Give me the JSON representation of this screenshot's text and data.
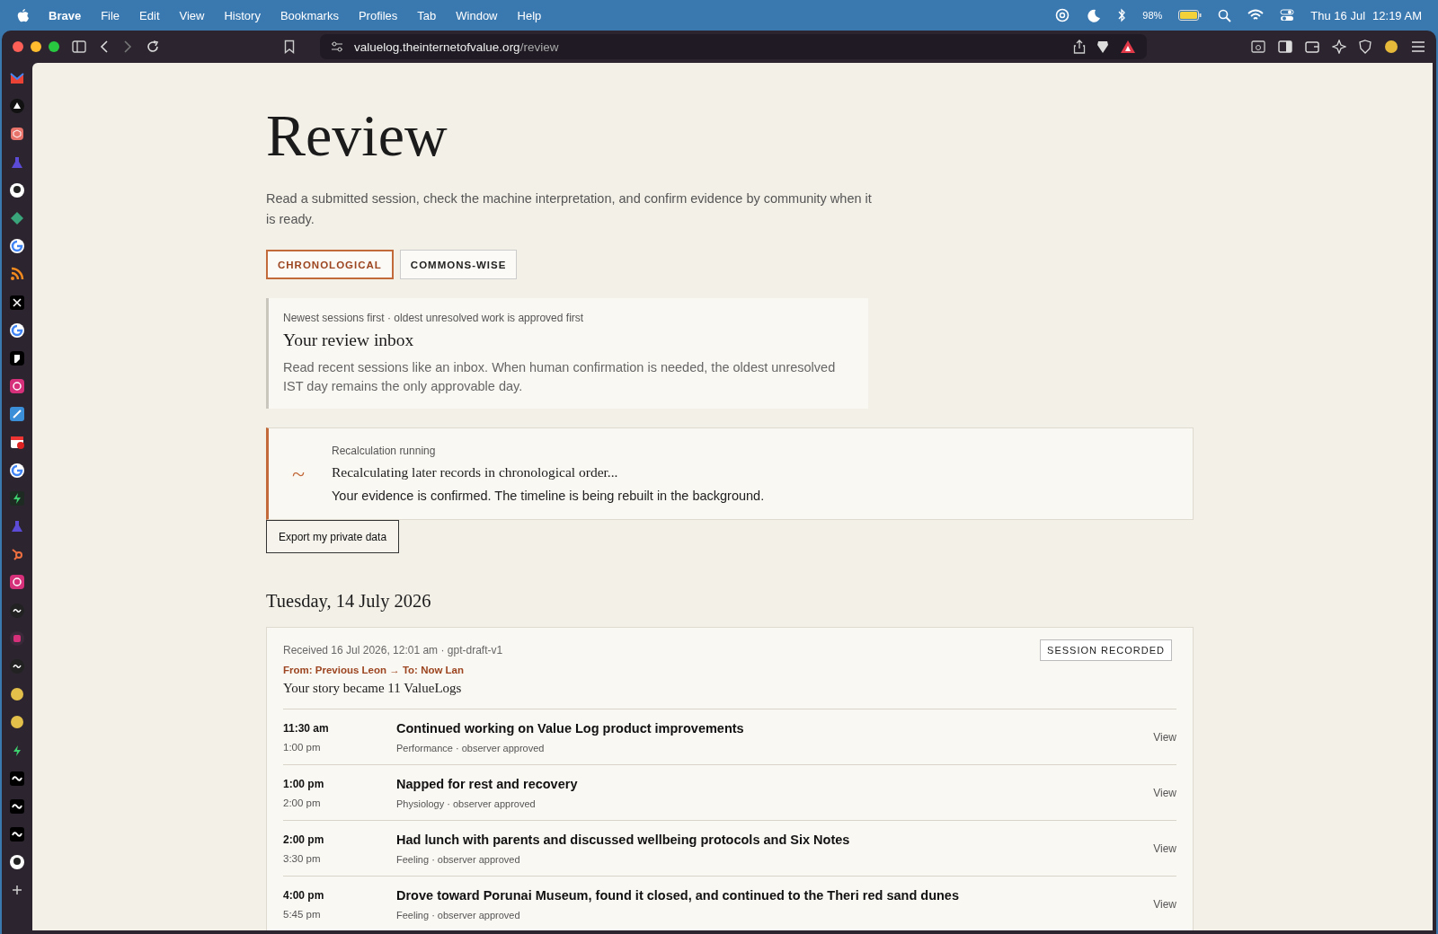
{
  "menu_bar": {
    "app": "Brave",
    "items": [
      "File",
      "Edit",
      "View",
      "History",
      "Bookmarks",
      "Profiles",
      "Tab",
      "Window",
      "Help"
    ],
    "battery": "98%",
    "date": "Thu 16 Jul",
    "time": "12:19 AM"
  },
  "browser": {
    "url_host": "valuelog.theinternetofvalue.org",
    "url_path": "/review"
  },
  "page": {
    "title": "Review",
    "description": "Read a submitted session, check the machine interpretation, and confirm evidence by community when it is ready.",
    "tabs": [
      {
        "label": "CHRONOLOGICAL",
        "selected": true
      },
      {
        "label": "COMMONS-WISE",
        "selected": false
      }
    ],
    "inbox": {
      "eyebrow": "Newest sessions first · oldest unresolved work is approved first",
      "title": "Your review inbox",
      "body": "Read recent sessions like an inbox. When human confirmation is needed, the oldest unresolved IST day remains the only approvable day."
    },
    "notice": {
      "icon": "~",
      "eyebrow": "Recalculation running",
      "title": "Recalculating later records in chronological order...",
      "body": "Your evidence is confirmed. The timeline is being rebuilt in the background."
    },
    "export_button": "Export my private data",
    "day_heading": "Tuesday, 14 July 2026",
    "session": {
      "received": "Received 16 Jul 2026, 12:01 am · gpt-draft-v1",
      "route": "From: Previous Leon → To: Now Lan",
      "summary": "Your story became 11 ValueLogs",
      "badge": "SESSION RECORDED",
      "rows": [
        {
          "start": "11:30 am",
          "end": "1:00 pm",
          "title": "Continued working on Value Log product improvements",
          "meta": "Performance · observer approved",
          "action": "View"
        },
        {
          "start": "1:00 pm",
          "end": "2:00 pm",
          "title": "Napped for rest and recovery",
          "meta": "Physiology · observer approved",
          "action": "View"
        },
        {
          "start": "2:00 pm",
          "end": "3:30 pm",
          "title": "Had lunch with parents and discussed wellbeing protocols and Six Notes",
          "meta": "Feeling · observer approved",
          "action": "View"
        },
        {
          "start": "4:00 pm",
          "end": "5:45 pm",
          "title": "Drove toward Porunai Museum, found it closed, and continued to the Theri red sand dunes",
          "meta": "Feeling · observer approved",
          "action": "View"
        }
      ]
    }
  }
}
